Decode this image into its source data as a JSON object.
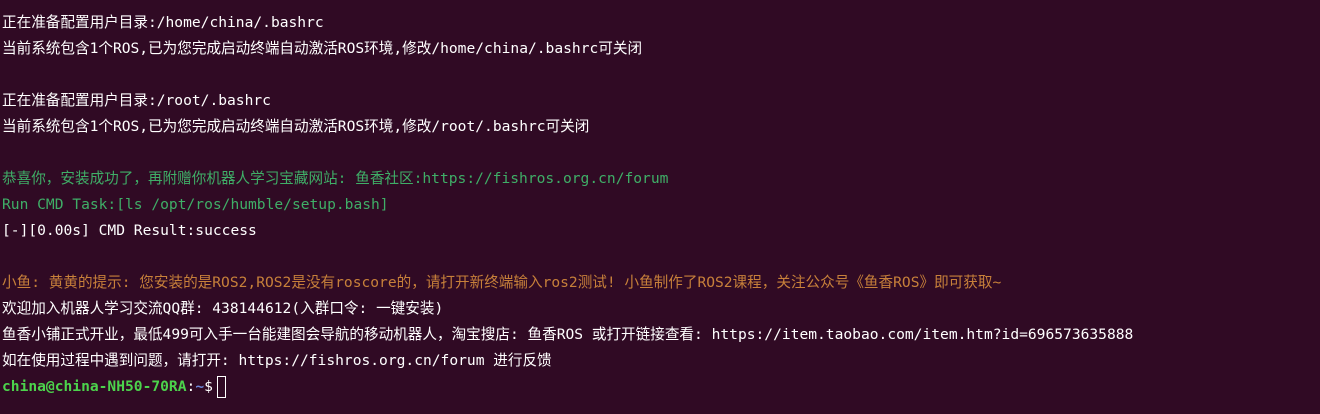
{
  "terminal": {
    "lines": [
      {
        "text": "正在准备配置用户目录:/home/china/.bashrc",
        "style": "normal"
      },
      {
        "text": "当前系统包含1个ROS,已为您完成启动终端自动激活ROS环境,修改/home/china/.bashrc可关闭",
        "style": "normal"
      },
      {
        "text": "",
        "style": "blank"
      },
      {
        "text": "正在准备配置用户目录:/root/.bashrc",
        "style": "normal"
      },
      {
        "text": "当前系统包含1个ROS,已为您完成启动终端自动激活ROS环境,修改/root/.bashrc可关闭",
        "style": "normal"
      },
      {
        "text": "",
        "style": "blank"
      },
      {
        "text": "恭喜你，安装成功了，再附赠你机器人学习宝藏网站: 鱼香社区:https://fishros.org.cn/forum",
        "style": "green"
      },
      {
        "text": "Run CMD Task:[ls /opt/ros/humble/setup.bash]",
        "style": "green"
      },
      {
        "text": "[-][0.00s] CMD Result:success",
        "style": "normal"
      },
      {
        "text": "",
        "style": "blank"
      },
      {
        "text": "小鱼: 黄黄的提示: 您安装的是ROS2,ROS2是没有roscore的，请打开新终端输入ros2测试! 小鱼制作了ROS2课程，关注公众号《鱼香ROS》即可获取~",
        "style": "orange"
      },
      {
        "text": "欢迎加入机器人学习交流QQ群: 438144612(入群口令: 一键安装)",
        "style": "normal"
      },
      {
        "text": "鱼香小铺正式开业，最低499可入手一台能建图会导航的移动机器人，淘宝搜店: 鱼香ROS 或打开链接查看: https://item.taobao.com/item.htm?id=696573635888",
        "style": "normal"
      },
      {
        "text": "如在使用过程中遇到问题，请打开: https://fishros.org.cn/forum 进行反馈",
        "style": "normal"
      }
    ],
    "prompt": {
      "user_host": "china@china-NH50-70RA",
      "separator": ":",
      "path": "~",
      "symbol": "$"
    },
    "colors": {
      "background": "#300a24",
      "text": "#ffffff",
      "green": "#3fae67",
      "orange": "#c7803a",
      "prompt_user": "#4cd34c",
      "prompt_path": "#6b86d8"
    }
  }
}
